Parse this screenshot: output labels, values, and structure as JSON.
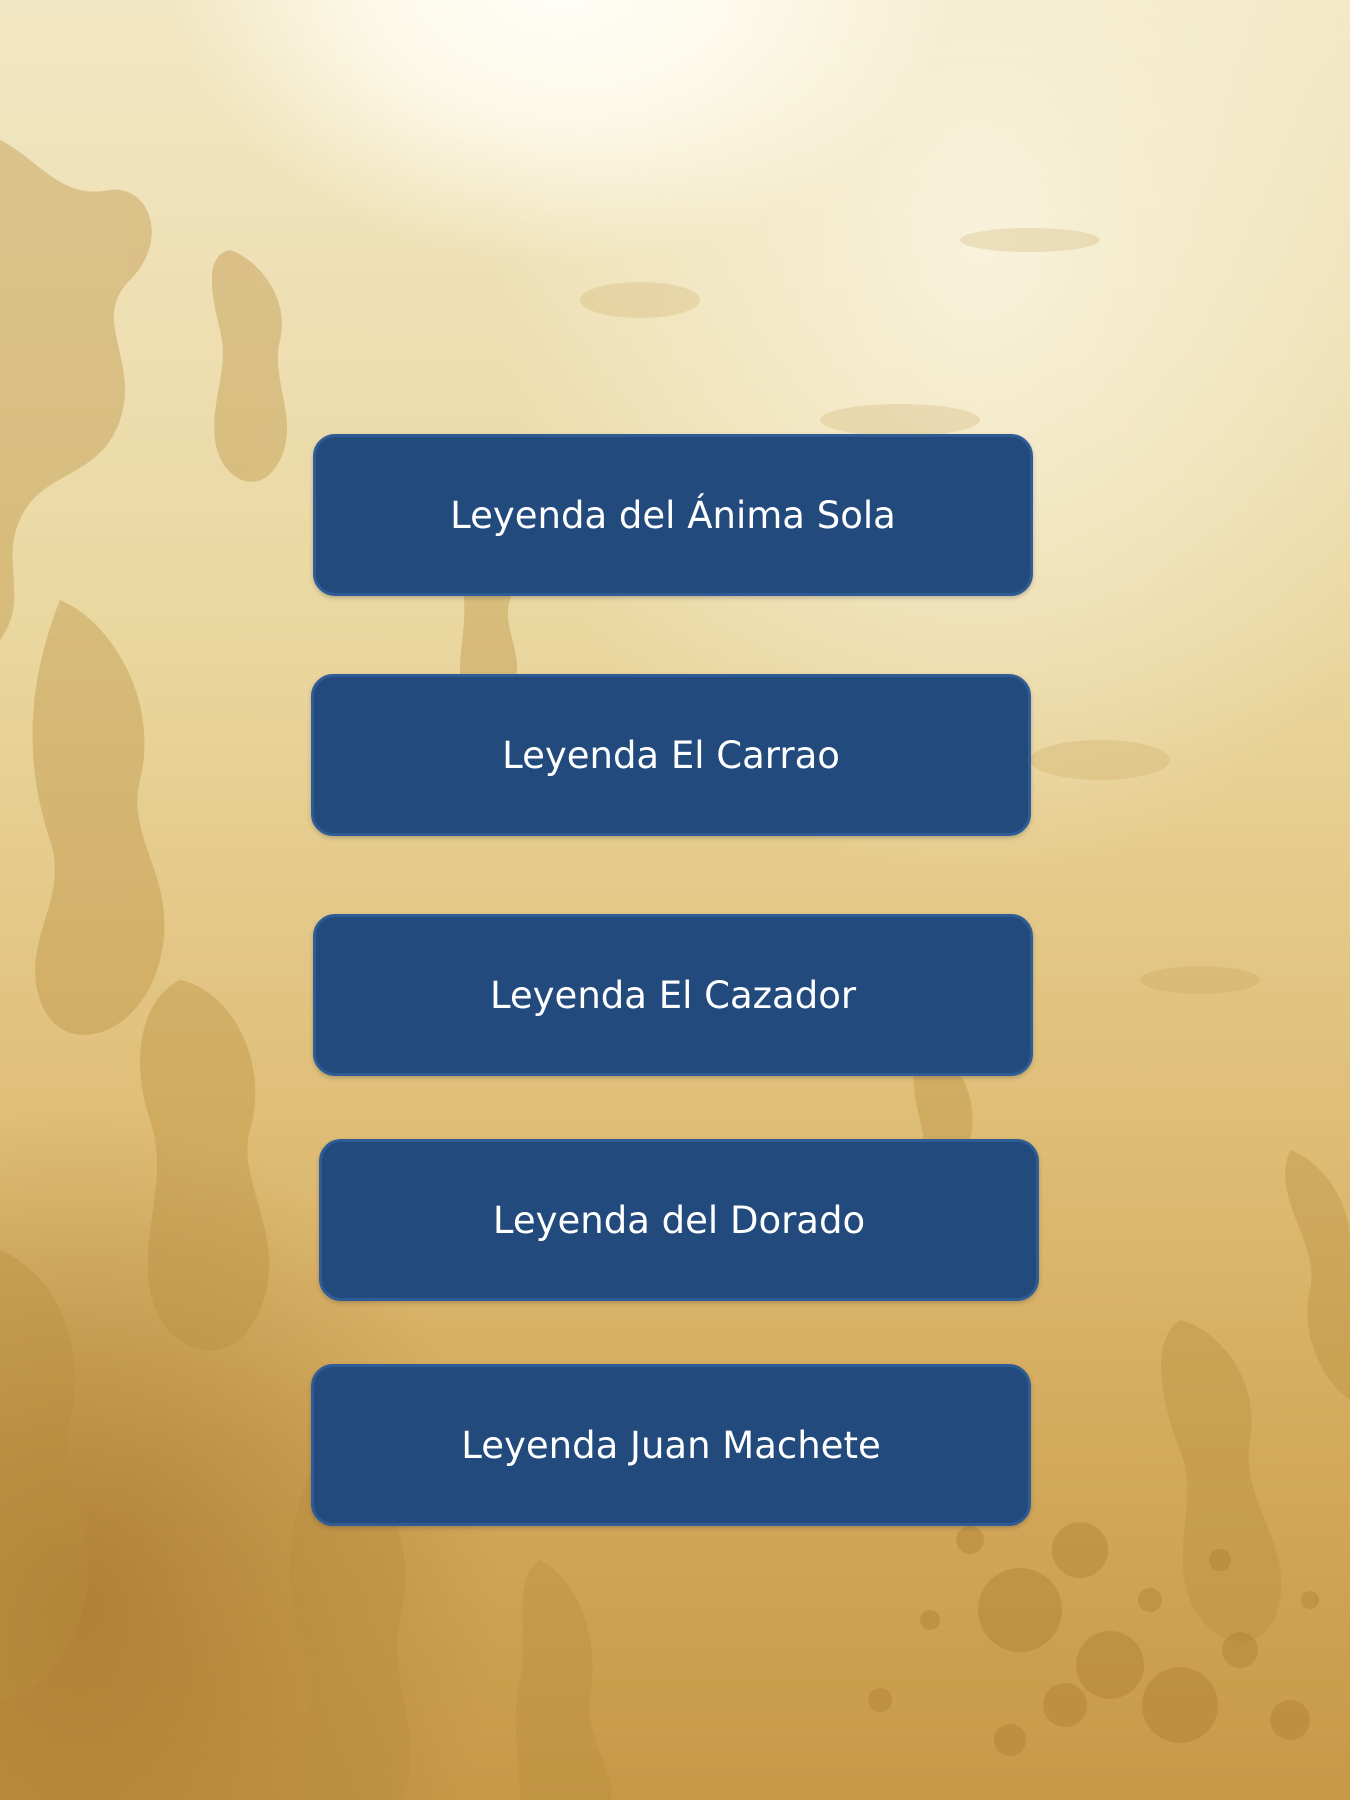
{
  "menu": {
    "items": [
      {
        "label": "Leyenda del Ánima Sola"
      },
      {
        "label": "Leyenda El Carrao"
      },
      {
        "label": "Leyenda El Cazador"
      },
      {
        "label": "Leyenda del Dorado"
      },
      {
        "label": "Leyenda Juan Machete"
      }
    ]
  },
  "colors": {
    "button_fill": "#224a7d",
    "button_border": "#2f5c94",
    "button_text": "#ffffff",
    "background_light": "#f2e7c4",
    "background_dark": "#c79848"
  }
}
